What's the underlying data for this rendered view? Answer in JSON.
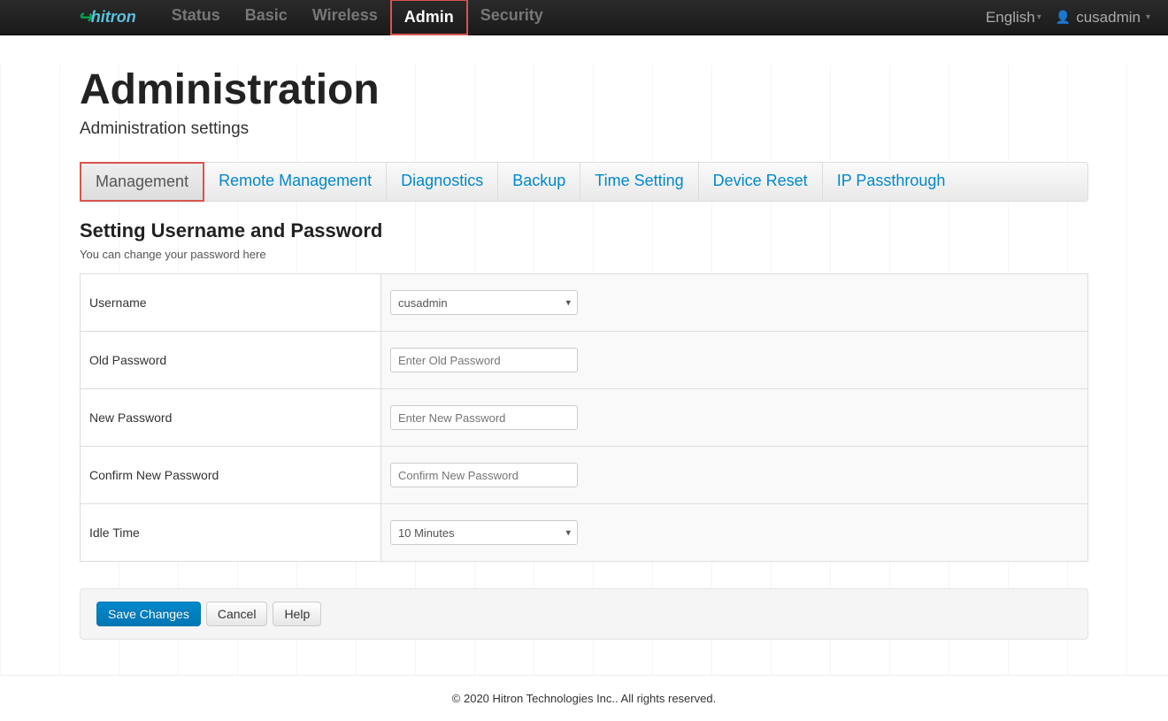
{
  "brand": {
    "swoosh": "↪",
    "first": "h",
    "rest": "itron"
  },
  "nav": {
    "items": [
      {
        "label": "Status",
        "active": false
      },
      {
        "label": "Basic",
        "active": false
      },
      {
        "label": "Wireless",
        "active": false
      },
      {
        "label": "Admin",
        "active": true
      },
      {
        "label": "Security",
        "active": false
      }
    ],
    "language": "English",
    "username": "cusadmin"
  },
  "page": {
    "title": "Administration",
    "subtitle": "Administration settings"
  },
  "tabs": [
    {
      "label": "Management",
      "active": true
    },
    {
      "label": "Remote Management",
      "active": false
    },
    {
      "label": "Diagnostics",
      "active": false
    },
    {
      "label": "Backup",
      "active": false
    },
    {
      "label": "Time Setting",
      "active": false
    },
    {
      "label": "Device Reset",
      "active": false
    },
    {
      "label": "IP Passthrough",
      "active": false
    }
  ],
  "section": {
    "title": "Setting Username and Password",
    "desc": "You can change your password here"
  },
  "form": {
    "rows": [
      {
        "label": "Username"
      },
      {
        "label": "Old Password"
      },
      {
        "label": "New Password"
      },
      {
        "label": "Confirm New Password"
      },
      {
        "label": "Idle Time"
      }
    ],
    "username_value": "cusadmin",
    "old_password_placeholder": "Enter Old Password",
    "new_password_placeholder": "Enter New Password",
    "confirm_password_placeholder": "Confirm New Password",
    "idle_time_value": "10 Minutes"
  },
  "buttons": {
    "save": "Save Changes",
    "cancel": "Cancel",
    "help": "Help"
  },
  "footer": "© 2020 Hitron Technologies Inc.. All rights reserved."
}
